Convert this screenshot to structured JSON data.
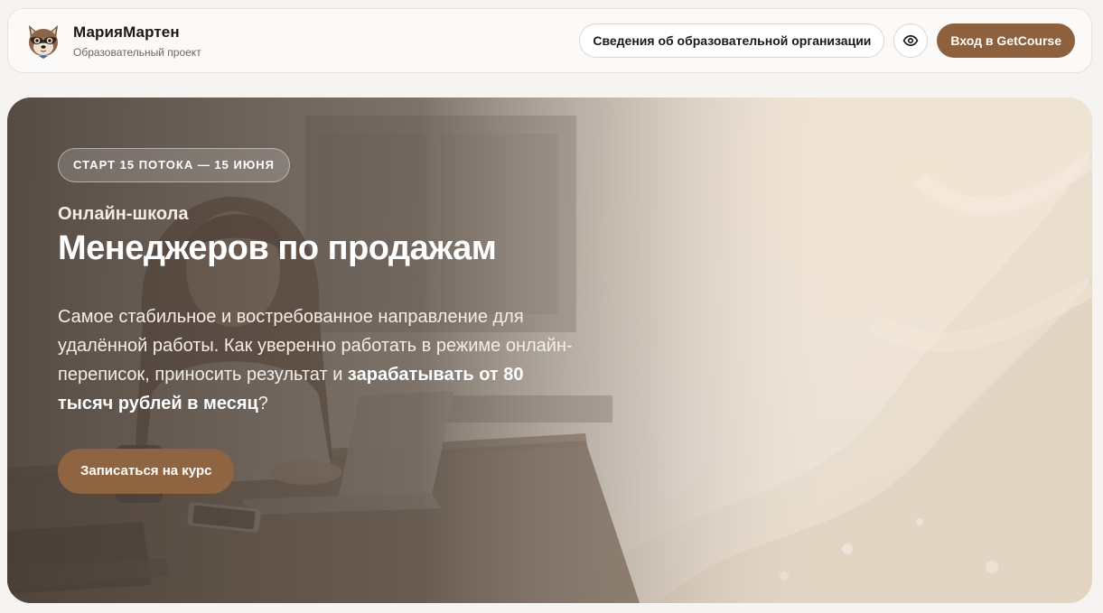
{
  "header": {
    "brand_name": "МарияМартен",
    "brand_subtitle": "Образовательный проект",
    "org_info_label": "Сведения об образовательной организации",
    "login_label": "Вход в GetCourse"
  },
  "hero": {
    "badge": "СТАРТ 15 ПОТОКА — 15 ИЮНЯ",
    "eyebrow": "Онлайн-школа",
    "title": "Менеджеров по продажам",
    "description_part1": "Самое стабильное и востребованное направление для удалённой работы. Как уверенно работать в режиме онлайн-переписок, приносить результат и ",
    "description_bold": "зарабатывать от 80 тысяч рублей в месяц",
    "description_part2": "?",
    "cta_label": "Записаться на курс"
  },
  "colors": {
    "accent": "#8d603e",
    "page_background": "#f6f4f1",
    "hero_overlay": "#5e534a"
  },
  "icons": {
    "logo": "raccoon-logo-icon",
    "accessibility": "eye-icon"
  }
}
